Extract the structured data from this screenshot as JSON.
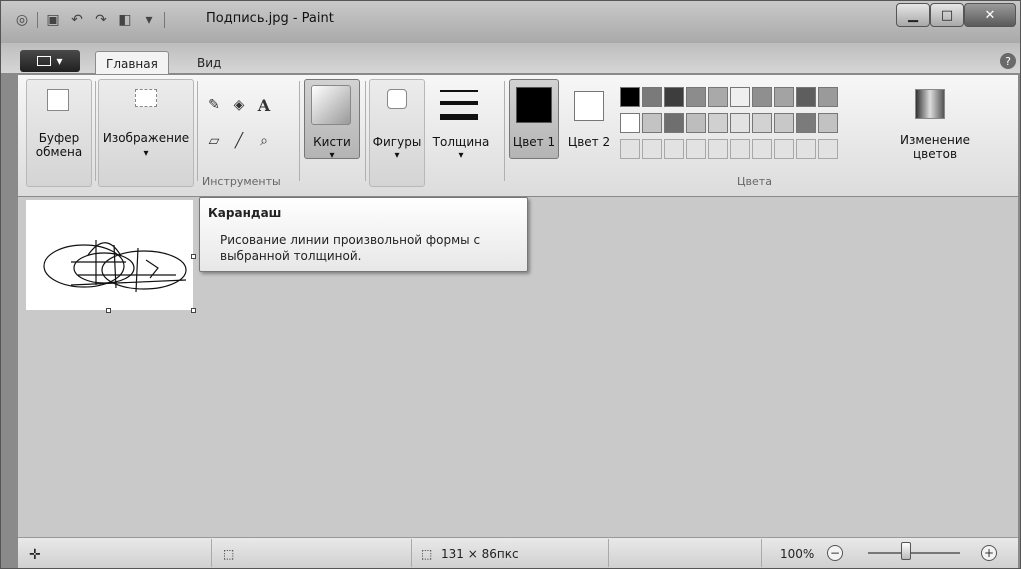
{
  "titlebar": {
    "title": "Подпись.jpg - Paint",
    "minimize_icon": "minimize-icon",
    "maximize_icon": "maximize-icon",
    "close_icon": "close-icon"
  },
  "tabs": {
    "app_menu": "▾",
    "home": "Главная",
    "view": "Вид"
  },
  "ribbon": {
    "clipboard": "Буфер обмена",
    "image": "Изображение",
    "tools_group": "Инструменты",
    "brushes": "Кисти",
    "shapes": "Фигуры",
    "size": "Толщина",
    "color1": "Цвет 1",
    "color2": "Цвет 2",
    "colors_group": "Цвета",
    "edit_colors": "Изменение цветов"
  },
  "palette": {
    "row1": [
      "#000000",
      "#7a7a7a",
      "#3d3d3d",
      "#8c8c8c",
      "#a9a9a9",
      "#efefef",
      "#8f8f8f",
      "#a3a3a3",
      "#5e5e5e",
      "#9a9a9a"
    ],
    "row2": [
      "#ffffff",
      "#c3c3c3",
      "#6f6f6f",
      "#bdbdbd",
      "#d0d0d0",
      "#e2e2e2",
      "#d2d2d2",
      "#c8c8c8",
      "#7b7b7b",
      "#c2c2c2"
    ]
  },
  "tooltip": {
    "title": "Карандаш",
    "body": "Рисование линии произвольной формы с выбранной толщиной."
  },
  "statusbar": {
    "image_size": "131 × 86пкс",
    "zoom": "100%"
  }
}
